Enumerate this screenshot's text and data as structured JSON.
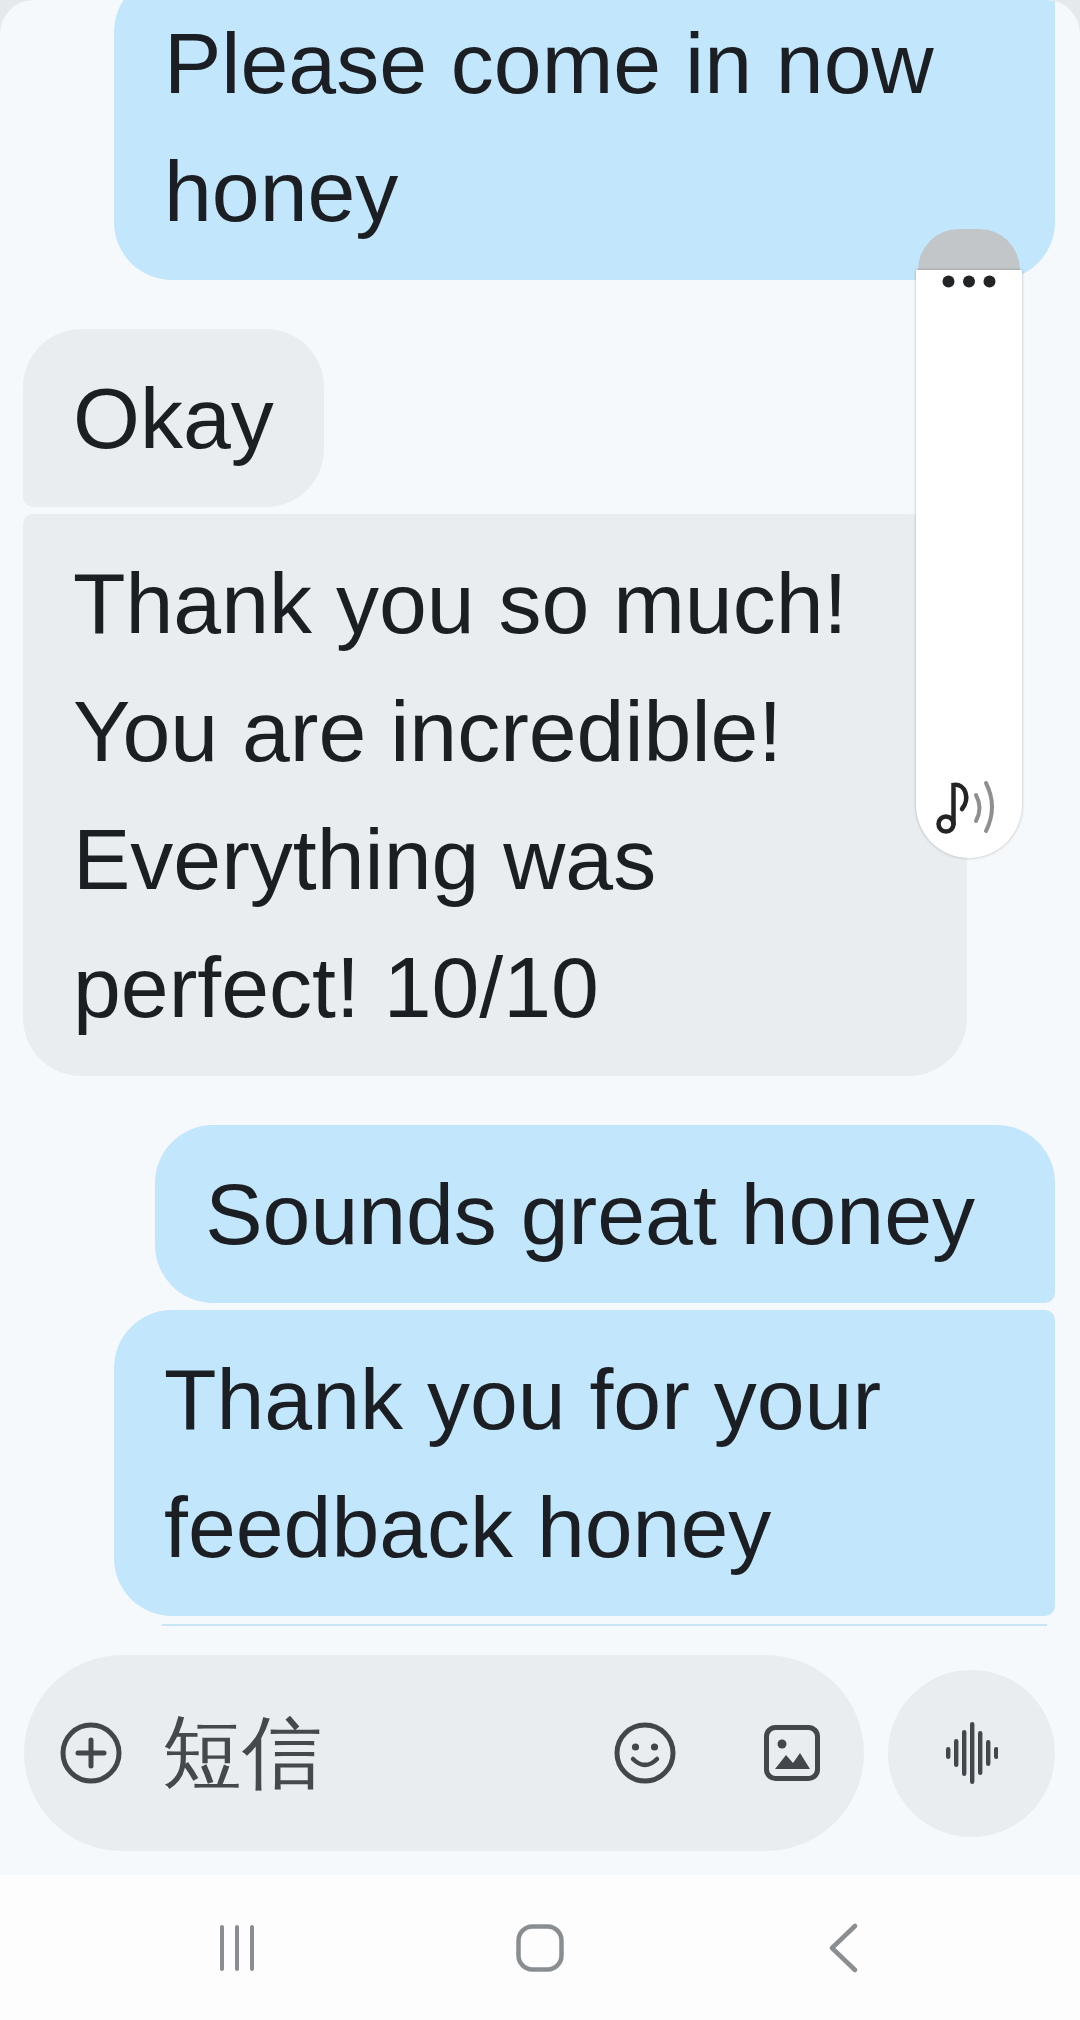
{
  "messages": [
    {
      "kind": "sent",
      "text": "Please come in now honey"
    },
    {
      "kind": "received",
      "text": "Okay"
    },
    {
      "kind": "received",
      "text": "Thank you so much! You are incredible! Everything was perfect! 10/10"
    },
    {
      "kind": "sent",
      "text": "Sounds great honey"
    },
    {
      "kind": "sent",
      "text": "Thank you for your feedback honey"
    }
  ],
  "composer": {
    "placeholder": "短信"
  }
}
